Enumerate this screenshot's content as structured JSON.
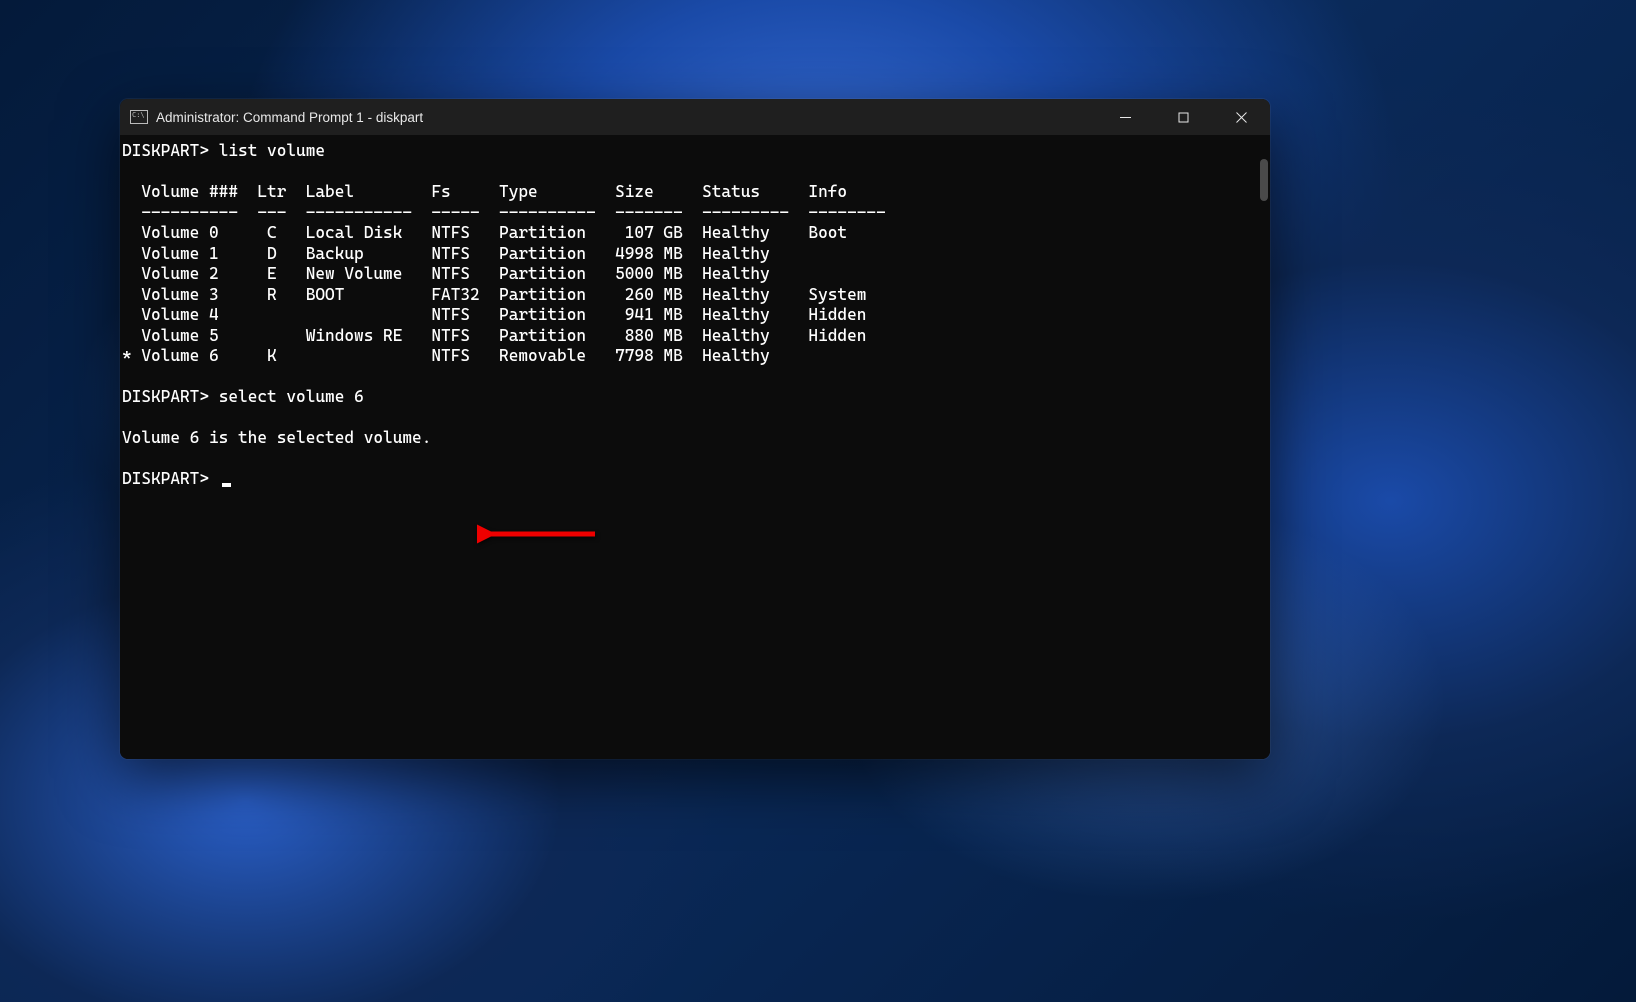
{
  "window": {
    "title": "Administrator: Command Prompt 1 - diskpart"
  },
  "terminal": {
    "prompt": "DISKPART>",
    "line1_cmd": "list volume",
    "header_line": "  Volume ###  Ltr  Label        Fs     Type        Size     Status     Info",
    "divider_line": "  ----------  ---  -----------  -----  ----------  -------  ---------  --------",
    "rows": [
      "  Volume 0     C   Local Disk   NTFS   Partition    107 GB  Healthy    Boot",
      "  Volume 1     D   Backup       NTFS   Partition   4998 MB  Healthy",
      "  Volume 2     E   New Volume   NTFS   Partition   5000 MB  Healthy",
      "  Volume 3     R   BOOT         FAT32  Partition    260 MB  Healthy    System",
      "  Volume 4                      NTFS   Partition    941 MB  Healthy    Hidden",
      "  Volume 5         Windows RE   NTFS   Partition    880 MB  Healthy    Hidden",
      "* Volume 6     K                NTFS   Removable   7798 MB  Healthy"
    ],
    "line2_cmd": "select volume 6",
    "response": "Volume 6 is the selected volume.",
    "prompt3": "DISKPART> "
  },
  "annotation": {
    "color": "#ef0000"
  }
}
